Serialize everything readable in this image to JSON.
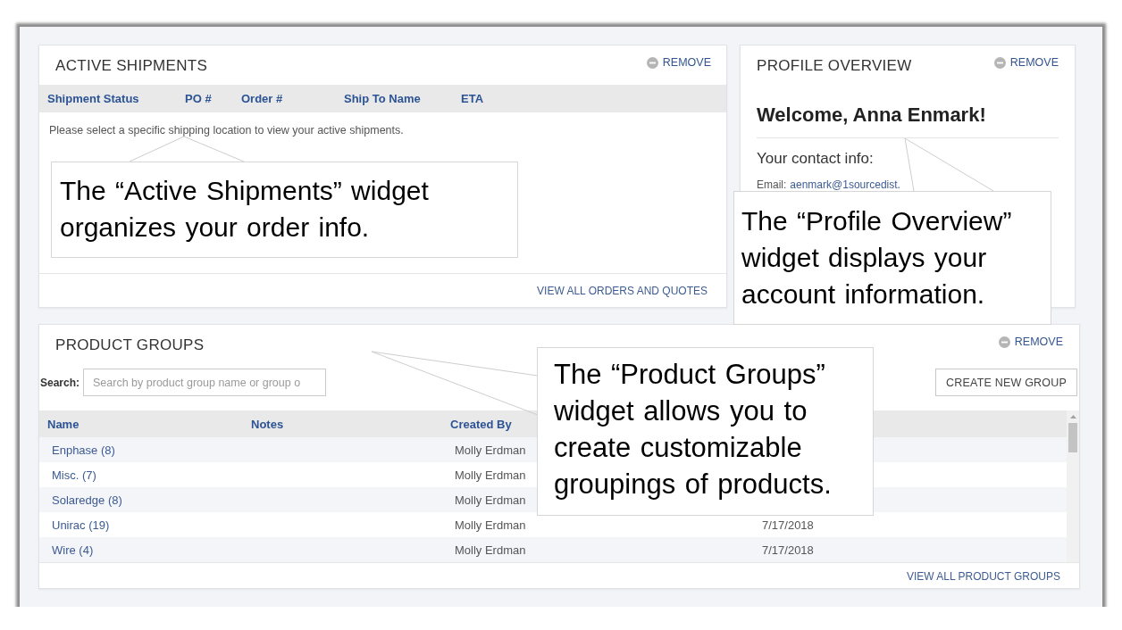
{
  "active_shipments": {
    "title": "ACTIVE SHIPMENTS",
    "remove": "REMOVE",
    "columns": [
      "Shipment Status",
      "PO #",
      "Order #",
      "Ship To Name",
      "ETA"
    ],
    "message": "Please select a specific shipping location to view your active shipments.",
    "footer_link": "VIEW ALL ORDERS AND QUOTES",
    "callout": "The “Active Shipments” widget organizes your order info."
  },
  "profile_overview": {
    "title": "PROFILE OVERVIEW",
    "remove": "REMOVE",
    "welcome": "Welcome, Anna Enmark!",
    "contact_heading": "Your contact info:",
    "email_label": "Email:",
    "email": "aenmark@1sourcedist.",
    "callout": "The “Profile Overview” widget displays your account information."
  },
  "product_groups": {
    "title": "PRODUCT GROUPS",
    "remove": "REMOVE",
    "search_label": "Search:",
    "search": {
      "placeholder": "Search by product group name or group o"
    },
    "create_button": "CREATE NEW GROUP",
    "columns": [
      "Name",
      "Notes",
      "Created By"
    ],
    "rows": [
      {
        "name": "Enphase (8)",
        "created_by": "Molly Erdman"
      },
      {
        "name": "Misc. (7)",
        "created_by": "Molly Erdman"
      },
      {
        "name": "Solaredge (8)",
        "created_by": "Molly Erdman"
      },
      {
        "name": "Unirac (19)",
        "created_by": "Molly Erdman",
        "column_4": "7/17/2018"
      },
      {
        "name": "Wire (4)",
        "created_by": "Molly Erdman",
        "column_4": "7/17/2018"
      }
    ],
    "footer_link": "VIEW ALL PRODUCT GROUPS",
    "callout": "The “Product Groups” widget allows you to create customizable groupings of products."
  }
}
